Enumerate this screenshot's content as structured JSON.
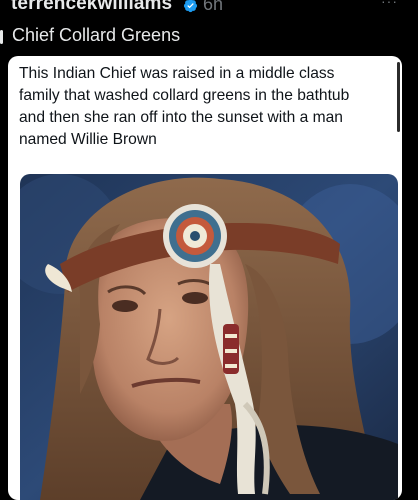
{
  "post": {
    "username": "terrencekwilliams",
    "time": "6h",
    "more_label": "···",
    "text": "Chief Collard Greens",
    "icons": {
      "verified": "verified-badge-icon",
      "more": "more-options-icon"
    }
  },
  "note": {
    "lines": [
      "This Indian Chief was raised in a middle class",
      "family that washed collard greens in the bathtub",
      "and then she ran off into the sunset with a man",
      "named Willie Brown"
    ]
  },
  "colors": {
    "background": "#000000",
    "text_primary": "#e7e9ea",
    "text_secondary": "#71767b",
    "verified_blue": "#1d9bf0",
    "note_bg": "#ffffff"
  }
}
